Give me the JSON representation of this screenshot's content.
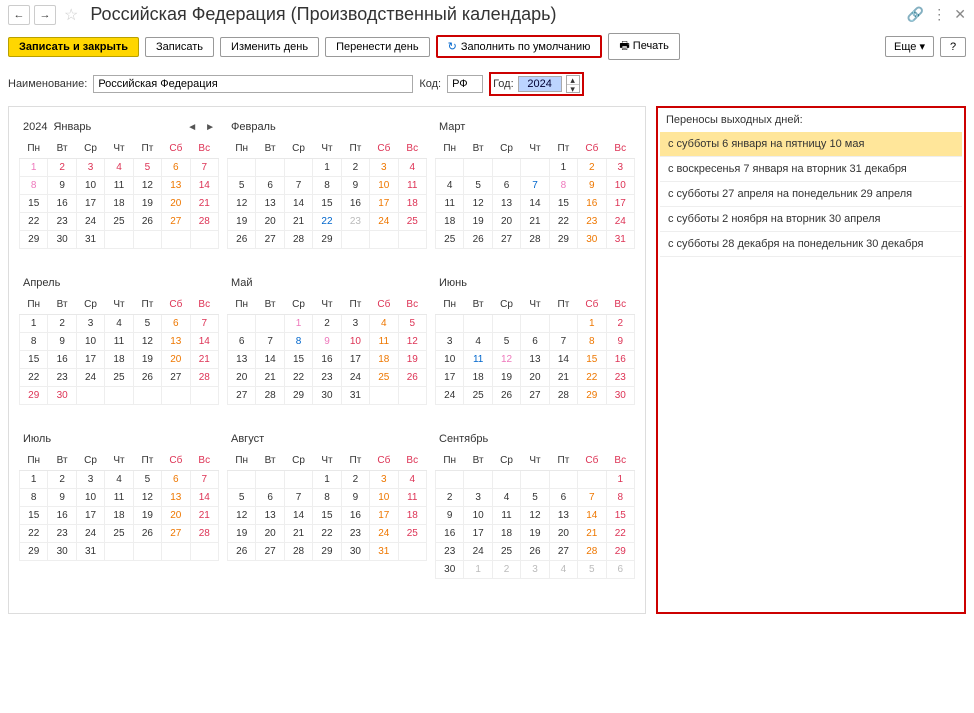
{
  "title": "Российская Федерация (Производственный календарь)",
  "toolbar": {
    "save_close": "Записать и закрыть",
    "save": "Записать",
    "change_day": "Изменить день",
    "move_day": "Перенести день",
    "fill_default": "Заполнить по умолчанию",
    "print": "Печать",
    "more": "Еще",
    "help": "?"
  },
  "form": {
    "name_label": "Наименование:",
    "name_value": "Российская Федерация",
    "code_label": "Код:",
    "code_value": "РФ",
    "year_label": "Год:",
    "year_value": "2024"
  },
  "year_header": "2024",
  "dow": [
    "Пн",
    "Вт",
    "Ср",
    "Чт",
    "Пт",
    "Сб",
    "Вс"
  ],
  "months": [
    {
      "name": "Январь",
      "show_year": true,
      "show_nav": true,
      "weeks": [
        [
          {
            "d": "1",
            "c": "pink"
          },
          {
            "d": "2",
            "c": "red"
          },
          {
            "d": "3",
            "c": "red"
          },
          {
            "d": "4",
            "c": "red"
          },
          {
            "d": "5",
            "c": "red"
          },
          {
            "d": "6",
            "c": "org"
          },
          {
            "d": "7",
            "c": "red"
          }
        ],
        [
          {
            "d": "8",
            "c": "pink"
          },
          {
            "d": "9"
          },
          {
            "d": "10"
          },
          {
            "d": "11"
          },
          {
            "d": "12"
          },
          {
            "d": "13",
            "c": "org"
          },
          {
            "d": "14",
            "c": "red"
          }
        ],
        [
          {
            "d": "15"
          },
          {
            "d": "16"
          },
          {
            "d": "17"
          },
          {
            "d": "18"
          },
          {
            "d": "19"
          },
          {
            "d": "20",
            "c": "org"
          },
          {
            "d": "21",
            "c": "red"
          }
        ],
        [
          {
            "d": "22"
          },
          {
            "d": "23"
          },
          {
            "d": "24"
          },
          {
            "d": "25"
          },
          {
            "d": "26"
          },
          {
            "d": "27",
            "c": "org"
          },
          {
            "d": "28",
            "c": "red"
          }
        ],
        [
          {
            "d": "29"
          },
          {
            "d": "30"
          },
          {
            "d": "31"
          },
          {
            "d": ""
          },
          {
            "d": ""
          },
          {
            "d": ""
          },
          {
            "d": ""
          }
        ]
      ]
    },
    {
      "name": "Февраль",
      "weeks": [
        [
          {
            "d": ""
          },
          {
            "d": ""
          },
          {
            "d": ""
          },
          {
            "d": "1"
          },
          {
            "d": "2"
          },
          {
            "d": "3",
            "c": "org"
          },
          {
            "d": "4",
            "c": "red"
          }
        ],
        [
          {
            "d": "5"
          },
          {
            "d": "6"
          },
          {
            "d": "7"
          },
          {
            "d": "8"
          },
          {
            "d": "9"
          },
          {
            "d": "10",
            "c": "org"
          },
          {
            "d": "11",
            "c": "red"
          }
        ],
        [
          {
            "d": "12"
          },
          {
            "d": "13"
          },
          {
            "d": "14"
          },
          {
            "d": "15"
          },
          {
            "d": "16"
          },
          {
            "d": "17",
            "c": "org"
          },
          {
            "d": "18",
            "c": "red"
          }
        ],
        [
          {
            "d": "19"
          },
          {
            "d": "20"
          },
          {
            "d": "21"
          },
          {
            "d": "22",
            "c": "blue"
          },
          {
            "d": "23",
            "c": "gray"
          },
          {
            "d": "24",
            "c": "org"
          },
          {
            "d": "25",
            "c": "red"
          }
        ],
        [
          {
            "d": "26"
          },
          {
            "d": "27"
          },
          {
            "d": "28"
          },
          {
            "d": "29"
          },
          {
            "d": ""
          },
          {
            "d": ""
          },
          {
            "d": ""
          }
        ]
      ]
    },
    {
      "name": "Март",
      "weeks": [
        [
          {
            "d": ""
          },
          {
            "d": ""
          },
          {
            "d": ""
          },
          {
            "d": ""
          },
          {
            "d": "1"
          },
          {
            "d": "2",
            "c": "org"
          },
          {
            "d": "3",
            "c": "red"
          }
        ],
        [
          {
            "d": "4"
          },
          {
            "d": "5"
          },
          {
            "d": "6"
          },
          {
            "d": "7",
            "c": "blue"
          },
          {
            "d": "8",
            "c": "pink"
          },
          {
            "d": "9",
            "c": "org"
          },
          {
            "d": "10",
            "c": "red"
          }
        ],
        [
          {
            "d": "11"
          },
          {
            "d": "12"
          },
          {
            "d": "13"
          },
          {
            "d": "14"
          },
          {
            "d": "15"
          },
          {
            "d": "16",
            "c": "org"
          },
          {
            "d": "17",
            "c": "red"
          }
        ],
        [
          {
            "d": "18"
          },
          {
            "d": "19"
          },
          {
            "d": "20"
          },
          {
            "d": "21"
          },
          {
            "d": "22"
          },
          {
            "d": "23",
            "c": "org"
          },
          {
            "d": "24",
            "c": "red"
          }
        ],
        [
          {
            "d": "25"
          },
          {
            "d": "26"
          },
          {
            "d": "27"
          },
          {
            "d": "28"
          },
          {
            "d": "29"
          },
          {
            "d": "30",
            "c": "org"
          },
          {
            "d": "31",
            "c": "red"
          }
        ]
      ]
    },
    {
      "name": "Апрель",
      "weeks": [
        [
          {
            "d": "1"
          },
          {
            "d": "2"
          },
          {
            "d": "3"
          },
          {
            "d": "4"
          },
          {
            "d": "5"
          },
          {
            "d": "6",
            "c": "org"
          },
          {
            "d": "7",
            "c": "red"
          }
        ],
        [
          {
            "d": "8"
          },
          {
            "d": "9"
          },
          {
            "d": "10"
          },
          {
            "d": "11"
          },
          {
            "d": "12"
          },
          {
            "d": "13",
            "c": "org"
          },
          {
            "d": "14",
            "c": "red"
          }
        ],
        [
          {
            "d": "15"
          },
          {
            "d": "16"
          },
          {
            "d": "17"
          },
          {
            "d": "18"
          },
          {
            "d": "19"
          },
          {
            "d": "20",
            "c": "org"
          },
          {
            "d": "21",
            "c": "red"
          }
        ],
        [
          {
            "d": "22"
          },
          {
            "d": "23"
          },
          {
            "d": "24"
          },
          {
            "d": "25"
          },
          {
            "d": "26"
          },
          {
            "d": "27"
          },
          {
            "d": "28",
            "c": "red"
          }
        ],
        [
          {
            "d": "29",
            "c": "red"
          },
          {
            "d": "30",
            "c": "red"
          },
          {
            "d": ""
          },
          {
            "d": ""
          },
          {
            "d": ""
          },
          {
            "d": ""
          },
          {
            "d": ""
          }
        ]
      ]
    },
    {
      "name": "Май",
      "weeks": [
        [
          {
            "d": ""
          },
          {
            "d": ""
          },
          {
            "d": "1",
            "c": "pink"
          },
          {
            "d": "2"
          },
          {
            "d": "3"
          },
          {
            "d": "4",
            "c": "org"
          },
          {
            "d": "5",
            "c": "red"
          }
        ],
        [
          {
            "d": "6"
          },
          {
            "d": "7"
          },
          {
            "d": "8",
            "c": "blue"
          },
          {
            "d": "9",
            "c": "pink"
          },
          {
            "d": "10",
            "c": "red"
          },
          {
            "d": "11",
            "c": "org"
          },
          {
            "d": "12",
            "c": "red"
          }
        ],
        [
          {
            "d": "13"
          },
          {
            "d": "14"
          },
          {
            "d": "15"
          },
          {
            "d": "16"
          },
          {
            "d": "17"
          },
          {
            "d": "18",
            "c": "org"
          },
          {
            "d": "19",
            "c": "red"
          }
        ],
        [
          {
            "d": "20"
          },
          {
            "d": "21"
          },
          {
            "d": "22"
          },
          {
            "d": "23"
          },
          {
            "d": "24"
          },
          {
            "d": "25",
            "c": "org"
          },
          {
            "d": "26",
            "c": "red"
          }
        ],
        [
          {
            "d": "27"
          },
          {
            "d": "28"
          },
          {
            "d": "29"
          },
          {
            "d": "30"
          },
          {
            "d": "31"
          },
          {
            "d": ""
          },
          {
            "d": ""
          }
        ]
      ]
    },
    {
      "name": "Июнь",
      "weeks": [
        [
          {
            "d": ""
          },
          {
            "d": ""
          },
          {
            "d": ""
          },
          {
            "d": ""
          },
          {
            "d": ""
          },
          {
            "d": "1",
            "c": "org"
          },
          {
            "d": "2",
            "c": "red"
          }
        ],
        [
          {
            "d": "3"
          },
          {
            "d": "4"
          },
          {
            "d": "5"
          },
          {
            "d": "6"
          },
          {
            "d": "7"
          },
          {
            "d": "8",
            "c": "org"
          },
          {
            "d": "9",
            "c": "red"
          }
        ],
        [
          {
            "d": "10"
          },
          {
            "d": "11",
            "c": "blue"
          },
          {
            "d": "12",
            "c": "pink"
          },
          {
            "d": "13"
          },
          {
            "d": "14"
          },
          {
            "d": "15",
            "c": "org"
          },
          {
            "d": "16",
            "c": "red"
          }
        ],
        [
          {
            "d": "17"
          },
          {
            "d": "18"
          },
          {
            "d": "19"
          },
          {
            "d": "20"
          },
          {
            "d": "21"
          },
          {
            "d": "22",
            "c": "org"
          },
          {
            "d": "23",
            "c": "red"
          }
        ],
        [
          {
            "d": "24"
          },
          {
            "d": "25"
          },
          {
            "d": "26"
          },
          {
            "d": "27"
          },
          {
            "d": "28"
          },
          {
            "d": "29",
            "c": "org"
          },
          {
            "d": "30",
            "c": "red"
          }
        ]
      ]
    },
    {
      "name": "Июль",
      "weeks": [
        [
          {
            "d": "1"
          },
          {
            "d": "2"
          },
          {
            "d": "3"
          },
          {
            "d": "4"
          },
          {
            "d": "5"
          },
          {
            "d": "6",
            "c": "org"
          },
          {
            "d": "7",
            "c": "red"
          }
        ],
        [
          {
            "d": "8"
          },
          {
            "d": "9"
          },
          {
            "d": "10"
          },
          {
            "d": "11"
          },
          {
            "d": "12"
          },
          {
            "d": "13",
            "c": "org"
          },
          {
            "d": "14",
            "c": "red"
          }
        ],
        [
          {
            "d": "15"
          },
          {
            "d": "16"
          },
          {
            "d": "17"
          },
          {
            "d": "18"
          },
          {
            "d": "19"
          },
          {
            "d": "20",
            "c": "org"
          },
          {
            "d": "21",
            "c": "red"
          }
        ],
        [
          {
            "d": "22"
          },
          {
            "d": "23"
          },
          {
            "d": "24"
          },
          {
            "d": "25"
          },
          {
            "d": "26"
          },
          {
            "d": "27",
            "c": "org"
          },
          {
            "d": "28",
            "c": "red"
          }
        ],
        [
          {
            "d": "29"
          },
          {
            "d": "30"
          },
          {
            "d": "31"
          },
          {
            "d": ""
          },
          {
            "d": ""
          },
          {
            "d": ""
          },
          {
            "d": ""
          }
        ]
      ]
    },
    {
      "name": "Август",
      "weeks": [
        [
          {
            "d": ""
          },
          {
            "d": ""
          },
          {
            "d": ""
          },
          {
            "d": "1"
          },
          {
            "d": "2"
          },
          {
            "d": "3",
            "c": "org"
          },
          {
            "d": "4",
            "c": "red"
          }
        ],
        [
          {
            "d": "5"
          },
          {
            "d": "6"
          },
          {
            "d": "7"
          },
          {
            "d": "8"
          },
          {
            "d": "9"
          },
          {
            "d": "10",
            "c": "org"
          },
          {
            "d": "11",
            "c": "red"
          }
        ],
        [
          {
            "d": "12"
          },
          {
            "d": "13"
          },
          {
            "d": "14"
          },
          {
            "d": "15"
          },
          {
            "d": "16"
          },
          {
            "d": "17",
            "c": "org"
          },
          {
            "d": "18",
            "c": "red"
          }
        ],
        [
          {
            "d": "19"
          },
          {
            "d": "20"
          },
          {
            "d": "21"
          },
          {
            "d": "22"
          },
          {
            "d": "23"
          },
          {
            "d": "24",
            "c": "org"
          },
          {
            "d": "25",
            "c": "red"
          }
        ],
        [
          {
            "d": "26"
          },
          {
            "d": "27"
          },
          {
            "d": "28"
          },
          {
            "d": "29"
          },
          {
            "d": "30"
          },
          {
            "d": "31",
            "c": "org"
          },
          {
            "d": ""
          }
        ]
      ]
    },
    {
      "name": "Сентябрь",
      "weeks": [
        [
          {
            "d": ""
          },
          {
            "d": ""
          },
          {
            "d": ""
          },
          {
            "d": ""
          },
          {
            "d": ""
          },
          {
            "d": ""
          },
          {
            "d": "1",
            "c": "red"
          }
        ],
        [
          {
            "d": "2"
          },
          {
            "d": "3"
          },
          {
            "d": "4"
          },
          {
            "d": "5"
          },
          {
            "d": "6"
          },
          {
            "d": "7",
            "c": "org"
          },
          {
            "d": "8",
            "c": "red"
          }
        ],
        [
          {
            "d": "9"
          },
          {
            "d": "10"
          },
          {
            "d": "11"
          },
          {
            "d": "12"
          },
          {
            "d": "13"
          },
          {
            "d": "14",
            "c": "org"
          },
          {
            "d": "15",
            "c": "red"
          }
        ],
        [
          {
            "d": "16"
          },
          {
            "d": "17"
          },
          {
            "d": "18"
          },
          {
            "d": "19"
          },
          {
            "d": "20"
          },
          {
            "d": "21",
            "c": "org"
          },
          {
            "d": "22",
            "c": "red"
          }
        ],
        [
          {
            "d": "23"
          },
          {
            "d": "24"
          },
          {
            "d": "25"
          },
          {
            "d": "26"
          },
          {
            "d": "27"
          },
          {
            "d": "28",
            "c": "org"
          },
          {
            "d": "29",
            "c": "red"
          }
        ],
        [
          {
            "d": "30"
          },
          {
            "d": "1",
            "c": "gray"
          },
          {
            "d": "2",
            "c": "gray"
          },
          {
            "d": "3",
            "c": "gray"
          },
          {
            "d": "4",
            "c": "gray"
          },
          {
            "d": "5",
            "c": "gray"
          },
          {
            "d": "6",
            "c": "gray"
          }
        ]
      ]
    }
  ],
  "side": {
    "title": "Переносы выходных дней:",
    "items": [
      "с субботы 6 января на пятницу 10 мая",
      "с воскресенья 7 января на вторник 31 декабря",
      "с субботы 27 апреля на понедельник 29 апреля",
      "с субботы 2 ноября на вторник 30 апреля",
      "с субботы 28 декабря на понедельник 30 декабря"
    ]
  }
}
